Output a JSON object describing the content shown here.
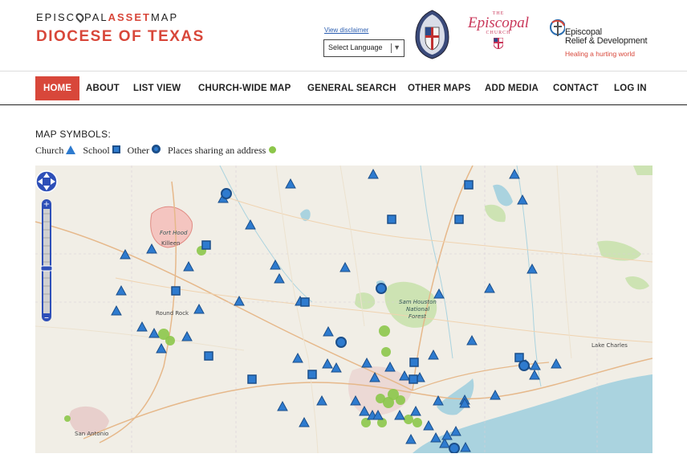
{
  "header": {
    "logo_part1": "EPISC",
    "logo_part2": "PAL",
    "logo_asset": "ASSET",
    "logo_map": "MAP",
    "site_title": "DIOCESE OF TEXAS",
    "disclaimer": "View disclaimer",
    "language_select": "Select Language",
    "episcopal_the": "THE",
    "episcopal_name": "Episcopal",
    "episcopal_church": "CHURCH",
    "erd_line1": "Episcopal",
    "erd_line2": "Relief & Development",
    "erd_tagline": "Healing a hurting world"
  },
  "nav": {
    "items": [
      {
        "label": "HOME",
        "active": true
      },
      {
        "label": "ABOUT"
      },
      {
        "label": "LIST VIEW"
      },
      {
        "label": "CHURCH-WIDE MAP"
      },
      {
        "label": "GENERAL SEARCH"
      },
      {
        "label": "OTHER MAPS"
      },
      {
        "label": "ADD MEDIA"
      },
      {
        "label": "CONTACT"
      },
      {
        "label": "LOG IN"
      }
    ]
  },
  "map_symbols": {
    "title": "MAP SYMBOLS:",
    "church": "Church",
    "school": "School",
    "other": "Other",
    "shared": "Places sharing an address"
  },
  "map": {
    "labels": {
      "fort_hood": "Fort Hood",
      "killeen": "Killeen",
      "round_rock": "Round Rock",
      "sam_houston_1": "Sam Houston",
      "sam_houston_2": "National",
      "sam_houston_3": "Forest",
      "lake_charles": "Lake Charles",
      "san_antonio": "San Antonio"
    },
    "colors": {
      "marker": "#2e7bcf",
      "marker_border": "#1c4f8a",
      "shared": "#8cc64a",
      "water": "#aad3df",
      "forest": "#cde3b3",
      "land": "#f1eee6"
    }
  },
  "colors": {
    "accent": "#d8473a",
    "link": "#2a5db0"
  }
}
